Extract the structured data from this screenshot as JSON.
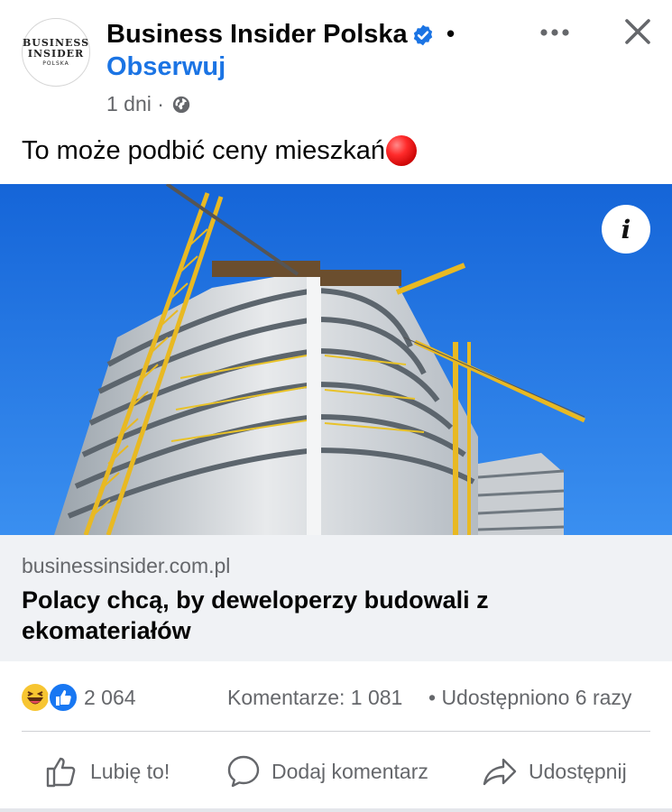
{
  "header": {
    "logo_line1": "BUSINESS",
    "logo_line2": "INSIDER",
    "logo_line3": "POLSKA",
    "page_name": "Business Insider Polska",
    "separator": "•",
    "follow_label": "Obserwuj",
    "time": "1 dni ·",
    "verified_icon": "verified-badge-icon",
    "privacy_icon": "globe-icon"
  },
  "post": {
    "text": "To może podbić ceny mieszkań",
    "emoji": "red-circle-emoji",
    "image_alt": "Construction of high-rise apartment building with yellow cranes against blue sky",
    "info_symbol": "i"
  },
  "link": {
    "domain": "businessinsider.com.pl",
    "title": "Polacy chcą, by deweloperzy budowali z ekomateriałów"
  },
  "stats": {
    "reaction_types": [
      "haha",
      "like"
    ],
    "reactions_count": "2 064",
    "comments_label": "Komentarze: 1 081",
    "shares_label": "• Udostępniono 6 razy"
  },
  "actions": {
    "like_label": "Lubię to!",
    "comment_label": "Dodaj komentarz",
    "share_label": "Udostępnij"
  },
  "colors": {
    "accent": "#1b74e4",
    "secondary_text": "#65676b",
    "link_bg": "#f0f2f5"
  }
}
